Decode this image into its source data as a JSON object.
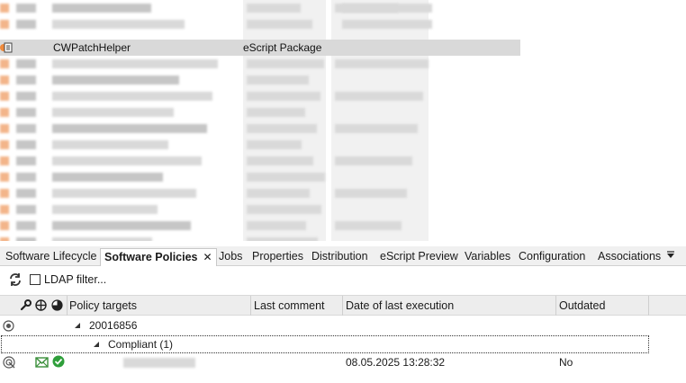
{
  "package_list": {
    "selected_row": {
      "name": "CWPatchHelper",
      "type": "eScript Package"
    }
  },
  "tabs": [
    {
      "label": "Software Lifecycle",
      "active": false
    },
    {
      "label": "Software Policies",
      "active": true,
      "close": "✕"
    },
    {
      "label": "Jobs",
      "active": false
    },
    {
      "label": "Properties",
      "active": false
    },
    {
      "label": "Distribution",
      "active": false
    },
    {
      "label": "eScript Preview",
      "active": false
    },
    {
      "label": "Variables",
      "active": false
    },
    {
      "label": "Configuration",
      "active": false
    },
    {
      "label": "Associations",
      "active": false
    }
  ],
  "tab_overflow_icon": "chevron-down-icon",
  "toolbar": {
    "ldap_filter_label": "LDAP filter...",
    "ldap_filter_checked": false
  },
  "grid": {
    "header_icons": [
      "wrench-icon",
      "deploy-icon",
      "status-pie-icon"
    ],
    "columns": {
      "policy_targets": "Policy targets",
      "last_comment": "Last comment",
      "date_of_last_execution": "Date of last execution",
      "outdated": "Outdated"
    },
    "group": {
      "label": "20016856"
    },
    "subgroup": {
      "label": "Compliant (1)"
    },
    "rows": [
      {
        "icons": [
          "target-icon",
          "envelope-icon",
          "check-circle-icon"
        ],
        "policy_target": "",
        "last_comment": "",
        "date_of_last_execution": "08.05.2025 13:28:32",
        "outdated": "No"
      }
    ]
  },
  "colors": {
    "accent_orange": "#f08a3c",
    "check_green": "#2e9e3a",
    "envelope_green": "#3a8f3a",
    "selected_row_bg": "#d9d9d9",
    "header_bg": "#ededed"
  }
}
